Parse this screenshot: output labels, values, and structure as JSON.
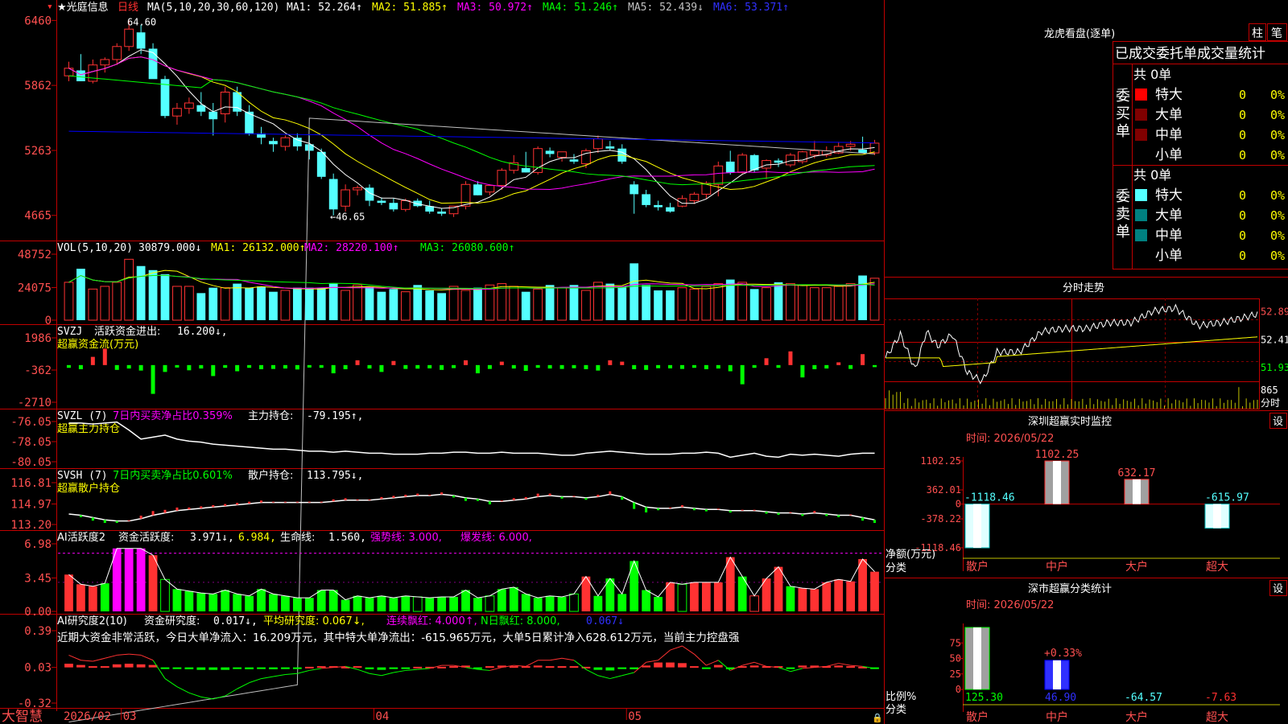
{
  "colors": {
    "up": "#ff3232",
    "down": "#54ffff",
    "grid": "#c00000",
    "axis_text": "#ff5050",
    "ma1": "#ffffff",
    "ma2": "#ffff00",
    "ma3": "#ff00ff",
    "ma4": "#00ff00",
    "ma5": "#c0c0c0",
    "ma6": "#0000ff",
    "green_bar": "#00ff00",
    "accent_purple": "#ff00ff"
  },
  "title_bar": {
    "star_name": "★光庭信息",
    "period": "日线",
    "ma_params": "MA(5,10,20,30,60,120)",
    "ma1": "MA1: 52.264↑",
    "ma2": "MA2: 51.885↑",
    "ma3": "MA3: 50.972↑",
    "ma4": "MA4: 51.246↑",
    "ma5": "MA5: 52.439↓",
    "ma6": "MA6: 53.371↑"
  },
  "kline": {
    "yticks": [
      "6460",
      "5862",
      "5263",
      "4665"
    ],
    "high_label": "64.60",
    "low_label": "←46.65",
    "dates": [
      "2026/02",
      "03",
      "04",
      "05"
    ],
    "candles_ohlc": [
      [
        59.5,
        60.8,
        59.0,
        60.2
      ],
      [
        60.0,
        61.5,
        59.0,
        59.0
      ],
      [
        59.0,
        61.0,
        58.8,
        60.5
      ],
      [
        60.5,
        61.2,
        59.8,
        61.0
      ],
      [
        61.0,
        62.5,
        60.5,
        62.2
      ],
      [
        62.2,
        64.6,
        61.8,
        63.8
      ],
      [
        63.5,
        64.2,
        61.5,
        62.0
      ],
      [
        62.0,
        62.5,
        60.0,
        59.2
      ],
      [
        59.2,
        59.5,
        55.6,
        55.8
      ],
      [
        55.8,
        57.0,
        55.0,
        56.5
      ],
      [
        56.5,
        57.5,
        56.0,
        57.0
      ],
      [
        56.8,
        58.0,
        55.8,
        56.2
      ],
      [
        56.2,
        57.0,
        54.0,
        55.5
      ],
      [
        56.0,
        58.5,
        55.2,
        58.0
      ],
      [
        58.0,
        58.5,
        55.8,
        56.2
      ],
      [
        56.2,
        56.8,
        54.0,
        54.2
      ],
      [
        54.2,
        54.8,
        53.2,
        53.8
      ],
      [
        53.5,
        53.8,
        52.5,
        53.2
      ],
      [
        53.0,
        54.0,
        52.6,
        53.8
      ],
      [
        53.8,
        54.2,
        52.6,
        53.0
      ],
      [
        53.2,
        54.0,
        51.8,
        52.6
      ],
      [
        52.5,
        52.8,
        50.0,
        50.2
      ],
      [
        50.0,
        50.5,
        46.65,
        47.2
      ],
      [
        47.5,
        49.5,
        47.0,
        49.0
      ],
      [
        49.0,
        49.4,
        48.5,
        49.2
      ],
      [
        49.2,
        49.5,
        47.5,
        48.0
      ],
      [
        48.0,
        48.3,
        47.6,
        47.8
      ],
      [
        47.8,
        48.2,
        47.0,
        47.2
      ],
      [
        47.2,
        48.2,
        47.0,
        48.0
      ],
      [
        48.0,
        48.2,
        47.4,
        47.5
      ],
      [
        47.5,
        48.0,
        46.8,
        47.0
      ],
      [
        47.0,
        47.3,
        46.6,
        46.8
      ],
      [
        46.8,
        47.5,
        46.5,
        47.5
      ],
      [
        47.5,
        49.8,
        47.2,
        49.5
      ],
      [
        49.5,
        49.8,
        48.5,
        48.5
      ],
      [
        48.8,
        49.5,
        48.5,
        49.4
      ],
      [
        49.4,
        51.0,
        49.0,
        50.8
      ],
      [
        50.8,
        52.2,
        50.5,
        51.5
      ],
      [
        51.0,
        52.5,
        50.6,
        50.6
      ],
      [
        50.6,
        53.0,
        50.4,
        52.8
      ],
      [
        52.6,
        52.9,
        52.0,
        52.3
      ],
      [
        52.0,
        52.5,
        51.6,
        52.5
      ],
      [
        51.8,
        52.3,
        51.4,
        51.6
      ],
      [
        51.4,
        52.8,
        51.0,
        52.6
      ],
      [
        52.8,
        54.0,
        52.4,
        53.7
      ],
      [
        53.0,
        53.5,
        52.6,
        52.8
      ],
      [
        52.8,
        53.2,
        51.4,
        51.6
      ],
      [
        49.5,
        49.8,
        46.8,
        48.6
      ],
      [
        48.6,
        49.0,
        47.4,
        47.6
      ],
      [
        47.6,
        48.0,
        47.1,
        47.4
      ],
      [
        47.4,
        47.8,
        46.9,
        47.0
      ],
      [
        47.5,
        48.5,
        47.4,
        48.2
      ],
      [
        48.0,
        48.8,
        47.7,
        48.6
      ],
      [
        48.6,
        49.8,
        48.2,
        49.6
      ],
      [
        49.5,
        51.6,
        48.4,
        51.2
      ],
      [
        51.6,
        52.6,
        50.4,
        50.6
      ],
      [
        50.6,
        52.4,
        50.5,
        52.2
      ],
      [
        52.2,
        52.3,
        50.6,
        50.8
      ],
      [
        51.0,
        51.8,
        50.0,
        51.7
      ],
      [
        51.7,
        51.9,
        51.1,
        51.5
      ],
      [
        51.3,
        52.4,
        51.1,
        52.2
      ],
      [
        51.6,
        52.6,
        51.4,
        52.5
      ],
      [
        52.2,
        53.5,
        51.9,
        52.6
      ],
      [
        52.2,
        53.0,
        52.0,
        52.6
      ],
      [
        52.4,
        53.4,
        52.3,
        53.0
      ],
      [
        53.0,
        53.5,
        52.6,
        53.2
      ],
      [
        52.7,
        53.9,
        52.5,
        52.4
      ],
      [
        52.4,
        53.6,
        52.2,
        53.3
      ]
    ]
  },
  "volume": {
    "header": "VOL(5,10,20)",
    "val": "30879.000↓",
    "ma1": "MA1: 26132.000↑",
    "ma2": "MA2: 28220.100↑",
    "ma3": "MA3: 26080.600↑",
    "yticks": [
      "48752",
      "24075",
      "0"
    ],
    "values": [
      28000,
      38000,
      23000,
      25000,
      28000,
      45000,
      40000,
      37000,
      34000,
      25000,
      25000,
      20000,
      24000,
      24000,
      27000,
      24000,
      25000,
      21000,
      22000,
      24000,
      24000,
      24000,
      27000,
      22000,
      26000,
      25000,
      21000,
      23000,
      21000,
      26000,
      22000,
      20000,
      25000,
      22000,
      24000,
      26000,
      27000,
      25000,
      21000,
      23000,
      26000,
      24000,
      26000,
      22000,
      28000,
      27000,
      25000,
      42000,
      26000,
      22000,
      22000,
      24000,
      23000,
      25000,
      27000,
      30000,
      28000,
      23000,
      24000,
      28000,
      27000,
      26000,
      24000,
      24000,
      25000,
      27000,
      33000,
      31000
    ]
  },
  "svzj": {
    "header": "SVZJ",
    "label": "活跃资金进出:",
    "value": "16.200↓,",
    "sub": "超赢资金流(万元)",
    "yticks": [
      "1986",
      "-362",
      "-2710"
    ],
    "values": [
      -200,
      -300,
      600,
      1200,
      -350,
      -250,
      -400,
      -2100,
      -500,
      -180,
      -380,
      -250,
      -800,
      -200,
      -450,
      -200,
      -300,
      -280,
      -250,
      -320,
      -180,
      -200,
      -600,
      -300,
      350,
      -250,
      -500,
      300,
      -280,
      -260,
      -240,
      -350,
      -220,
      350,
      -600,
      -280,
      250,
      -250,
      -420,
      -200,
      -250,
      -280,
      -230,
      -300,
      -400,
      350,
      250,
      -300,
      -350,
      -230,
      -240,
      -280,
      -200,
      -300,
      -250,
      -450,
      -1400,
      -200,
      500,
      -200,
      1000,
      -900,
      -300,
      -250,
      200,
      -280,
      800,
      -150
    ]
  },
  "svzl": {
    "header": "SVZL (7)",
    "pct": "7日内买卖净占比0.359%",
    "label": "主力持仓:",
    "value": "-79.195↑,",
    "sub": "超赢主力持仓",
    "yticks": [
      "-76.05",
      "-78.05",
      "-80.05"
    ],
    "values": [
      -76.2,
      -76.2,
      -76.3,
      -76.2,
      -76.1,
      -76.9,
      -77.8,
      -77.6,
      -77.4,
      -77.8,
      -78.0,
      -78.1,
      -78.3,
      -78.4,
      -78.5,
      -78.6,
      -78.7,
      -78.8,
      -78.8,
      -78.9,
      -79.0,
      -79.0,
      -79.1,
      -79.0,
      -79.1,
      -79.2,
      -79.2,
      -79.3,
      -79.3,
      -79.3,
      -79.2,
      -79.2,
      -79.1,
      -79.1,
      -79.2,
      -79.2,
      -79.1,
      -79.2,
      -79.2,
      -79.2,
      -79.3,
      -79.4,
      -79.4,
      -79.2,
      -79.1,
      -79.0,
      -79.1,
      -79.2,
      -79.3,
      -79.3,
      -79.3,
      -79.2,
      -79.2,
      -79.1,
      -79.2,
      -79.6,
      -79.4,
      -79.2,
      -79.5,
      -79.6,
      -79.3,
      -79.4,
      -79.3,
      -79.4,
      -79.5,
      -79.3,
      -79.2,
      -79.2
    ]
  },
  "svsh": {
    "header": "SVSH (7)",
    "pct": "7日内买卖净占比0.601%",
    "label": "散户持仓:",
    "value": "113.795↓,",
    "sub": "超赢散户持仓",
    "yticks": [
      "116.81",
      "114.97",
      "113.20"
    ],
    "values": [
      114.1,
      114.0,
      113.8,
      113.6,
      113.5,
      113.5,
      113.7,
      114.0,
      114.2,
      114.4,
      114.5,
      114.6,
      114.7,
      114.8,
      114.9,
      115.0,
      115.1,
      115.1,
      115.1,
      115.1,
      115.1,
      115.1,
      115.2,
      115.3,
      115.3,
      115.3,
      115.4,
      115.5,
      115.6,
      115.7,
      115.7,
      115.8,
      115.7,
      115.5,
      115.4,
      115.2,
      115.2,
      115.3,
      115.4,
      115.6,
      115.7,
      115.6,
      115.6,
      115.5,
      115.6,
      115.8,
      115.6,
      115.1,
      114.7,
      114.6,
      114.6,
      114.7,
      114.6,
      114.5,
      114.5,
      114.4,
      114.4,
      114.4,
      114.3,
      114.2,
      114.2,
      114.1,
      114.2,
      114.1,
      114.0,
      114.0,
      113.8,
      113.6
    ]
  },
  "ai_active": {
    "header": "AI活跃度2",
    "label": "资金活跃度:",
    "v1": "3.971↓,",
    "v2": "6.984,",
    "life_label": "生命线:",
    "life_val": "1.560,",
    "strong": "强势线: 3.000,",
    "burst": "爆发线: 6.000,",
    "yticks": [
      "6.98",
      "3.45",
      "0.00"
    ],
    "values": [
      3.8,
      2.8,
      2.6,
      2.9,
      6.5,
      6.5,
      6.5,
      5.8,
      3.3,
      2.3,
      2.1,
      1.9,
      1.8,
      2.2,
      1.8,
      1.6,
      2.3,
      1.8,
      1.6,
      1.4,
      1.4,
      2.2,
      2.2,
      1.2,
      1.6,
      1.4,
      1.6,
      1.4,
      1.6,
      1.5,
      1.4,
      1.5,
      1.5,
      2.2,
      1.4,
      1.6,
      2.3,
      2.5,
      1.8,
      1.4,
      1.6,
      1.5,
      1.8,
      3.6,
      1.6,
      3.4,
      1.8,
      5.2,
      2.2,
      1.5,
      3.0,
      2.8,
      3.0,
      3.0,
      3.0,
      5.6,
      3.6,
      1.6,
      3.4,
      4.6,
      2.6,
      2.4,
      2.3,
      3.0,
      3.3,
      3.1,
      5.4,
      4.1
    ],
    "up_flags": [
      1,
      1,
      1,
      0,
      1,
      1,
      1,
      1,
      0,
      0,
      0,
      0,
      0,
      0,
      0,
      0,
      0,
      0,
      0,
      0,
      0,
      0,
      0,
      0,
      0,
      0,
      0,
      0,
      0,
      0,
      0,
      0,
      0,
      0,
      0,
      0,
      0,
      0,
      0,
      0,
      0,
      0,
      0,
      1,
      0,
      0,
      0,
      0,
      0,
      0,
      1,
      0,
      1,
      1,
      1,
      1,
      0,
      1,
      1,
      1,
      0,
      1,
      1,
      1,
      1,
      1,
      1,
      1
    ]
  },
  "ai_research": {
    "header": "AI研究度2(10)",
    "label": "资金研究度:",
    "v1": "0.017↓,",
    "avg": "平均研究度: 0.067↓,",
    "lianxu": "连续飘红: 4.000↑,",
    "nday": "N日飘红: 8.000,",
    "last": "0.067↓",
    "comment": "近期大资金非常活跃，今日大单净流入：16.209万元，其中特大单净流出：-615.965万元，大单5日累计净入628.612万元，当前主力控盘强",
    "yticks": [
      "0.39",
      "0.03",
      "-0.32"
    ],
    "values": [
      0.06,
      0.04,
      0.02,
      0.02,
      0.05,
      0.06,
      0.05,
      0.04,
      -0.02,
      -0.02,
      -0.03,
      -0.04,
      -0.04,
      -0.04,
      -0.02,
      -0.03,
      -0.02,
      -0.03,
      -0.02,
      -0.02,
      0.01,
      0.02,
      0.02,
      0.01,
      0.02,
      -0.03,
      -0.04,
      -0.02,
      -0.02,
      0.01,
      0.01,
      0.01,
      0.02,
      0.03,
      -0.01,
      0.02,
      0.03,
      0.02,
      0.02,
      0.03,
      0.02,
      0.02,
      0.02,
      0.01,
      -0.04,
      -0.05,
      -0.02,
      -0.03,
      0.03,
      0.08,
      0.08,
      0.07,
      0.02,
      -0.02,
      0.04,
      -0.03,
      0.02,
      0.03,
      0.02,
      0.02,
      -0.02,
      0.03,
      0.03,
      0.02,
      0.03,
      0.02,
      0.01,
      -0.01
    ],
    "line": [
      0.15,
      0.1,
      0.09,
      0.12,
      0.15,
      0.16,
      0.15,
      0.1,
      -0.08,
      -0.16,
      -0.22,
      -0.26,
      -0.28,
      -0.25,
      -0.18,
      -0.12,
      -0.08,
      -0.06,
      -0.04,
      -0.03,
      0.0,
      0.02,
      0.03,
      0.04,
      0.01,
      -0.03,
      -0.05,
      -0.02,
      0.0,
      0.01,
      0.02,
      0.05,
      0.05,
      0.03,
      0.01,
      0.0,
      0.03,
      0.05,
      0.04,
      0.1,
      0.1,
      0.12,
      0.1,
      0.01,
      -0.05,
      -0.08,
      -0.05,
      -0.02,
      0.08,
      0.1,
      0.2,
      0.24,
      0.16,
      0.05,
      0.1,
      0.0,
      0.05,
      0.08,
      0.04,
      0.03,
      -0.01,
      0.02,
      0.03,
      0.04,
      0.07,
      0.05,
      0.04,
      0.02
    ]
  },
  "bottom_bar": {
    "brand": "大智慧"
  },
  "right": {
    "lhb": {
      "title": "龙虎看盘(逐单)",
      "btn1": "柱",
      "btn2": "笔",
      "table_title": "已成交委托单成交量统计",
      "buy_label": [
        "委",
        "买",
        "单"
      ],
      "sell_label": [
        "委",
        "卖",
        "单"
      ],
      "buy_count": "共 0单",
      "sell_count": "共 0单",
      "rows": [
        {
          "name": "特大",
          "val": "0",
          "pct": "0%"
        },
        {
          "name": "大单",
          "val": "0",
          "pct": "0%"
        },
        {
          "name": "中单",
          "val": "0",
          "pct": "0%"
        },
        {
          "name": "小单",
          "val": "0",
          "pct": "0%"
        }
      ],
      "buy_swatches": [
        "#ff0000",
        "#800000",
        "#800000",
        "#000000"
      ],
      "sell_swatches": [
        "#54ffff",
        "#008080",
        "#008080",
        "#000000"
      ]
    },
    "minute": {
      "title": "分时走势",
      "yticks": [
        "52.89",
        "52.41",
        "51.93"
      ],
      "vol_label": "865",
      "vol_unit": "分时"
    },
    "monitor": {
      "title": "深圳超赢实时监控",
      "btn": "设",
      "time": "时间: 2026/05/22",
      "yticks": [
        "1102.25",
        "362.01",
        "0",
        "-378.22",
        "-1118.46"
      ],
      "ylabel1": "净额(万元)",
      "ylabel2": "分类",
      "cats": [
        "散户",
        "中户",
        "大户",
        "超大"
      ],
      "bar_labels": [
        "-1118.46",
        "1102.25",
        "632.17",
        "-615.97"
      ],
      "values": [
        -1118.46,
        1102.25,
        632.17,
        -615.97
      ]
    },
    "classify": {
      "title": "深市超赢分类统计",
      "btn": "设",
      "time": "时间: 2026/05/22",
      "yticks": [
        "75",
        "50",
        "25",
        "0"
      ],
      "ylabel1": "比例%",
      "ylabel2": "分类",
      "cats": [
        "散户",
        "中户",
        "大户",
        "超大"
      ],
      "bottom_vals": [
        "125.30",
        "46.90",
        "-64.57",
        "-7.63"
      ],
      "pct_label": "+0.33%",
      "values": [
        125.3,
        46.9,
        -64.57,
        -7.63
      ]
    }
  }
}
